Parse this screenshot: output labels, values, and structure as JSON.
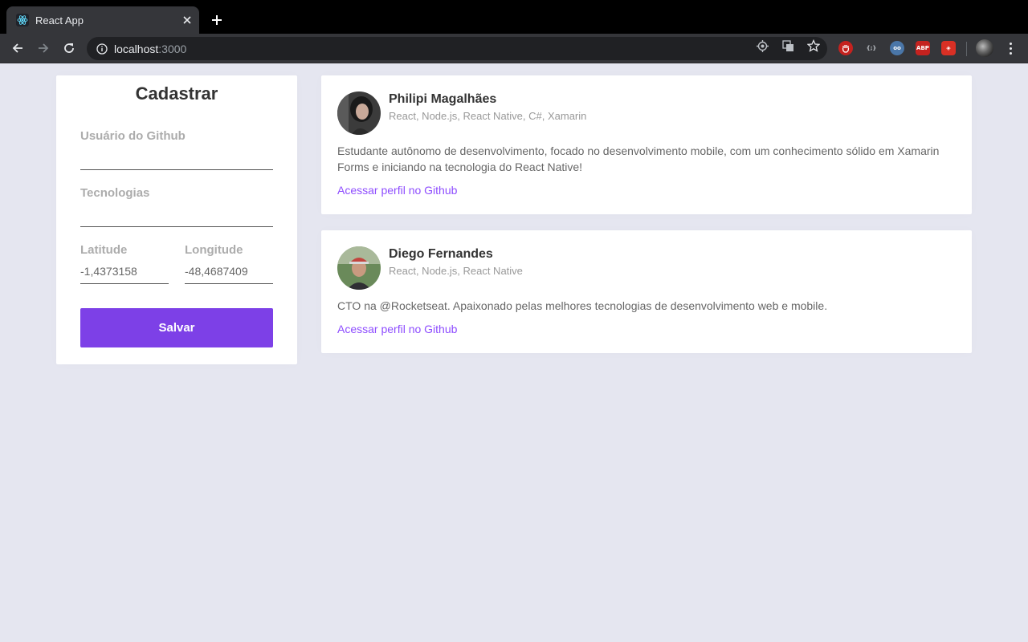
{
  "browser": {
    "tab_title": "React App",
    "url_host": "localhost",
    "url_port": ":3000"
  },
  "form": {
    "title": "Cadastrar",
    "github_label": "Usuário do Github",
    "github_value": "",
    "techs_label": "Tecnologias",
    "techs_value": "",
    "latitude_label": "Latitude",
    "latitude_value": "-1,4373158",
    "longitude_label": "Longitude",
    "longitude_value": "-48,4687409",
    "save_label": "Salvar",
    "accent_color": "#7d40e7"
  },
  "devs": [
    {
      "name": "Philipi Magalhães",
      "techs": "React, Node.js, React Native, C#, Xamarin",
      "bio": "Estudante autônomo de desenvolvimento, focado no desenvolvimento mobile, com um conhecimento sólido em Xamarin Forms e iniciando na tecnologia do React Native!",
      "link": "Acessar perfil no Github"
    },
    {
      "name": "Diego Fernandes",
      "techs": "React, Node.js, React Native",
      "bio": "CTO na @Rocketseat. Apaixonado pelas melhores tecnologias de desenvolvimento web e mobile.",
      "link": "Acessar perfil no Github"
    }
  ],
  "link_color": "#8e4dff",
  "background_color": "#e5e6f0"
}
